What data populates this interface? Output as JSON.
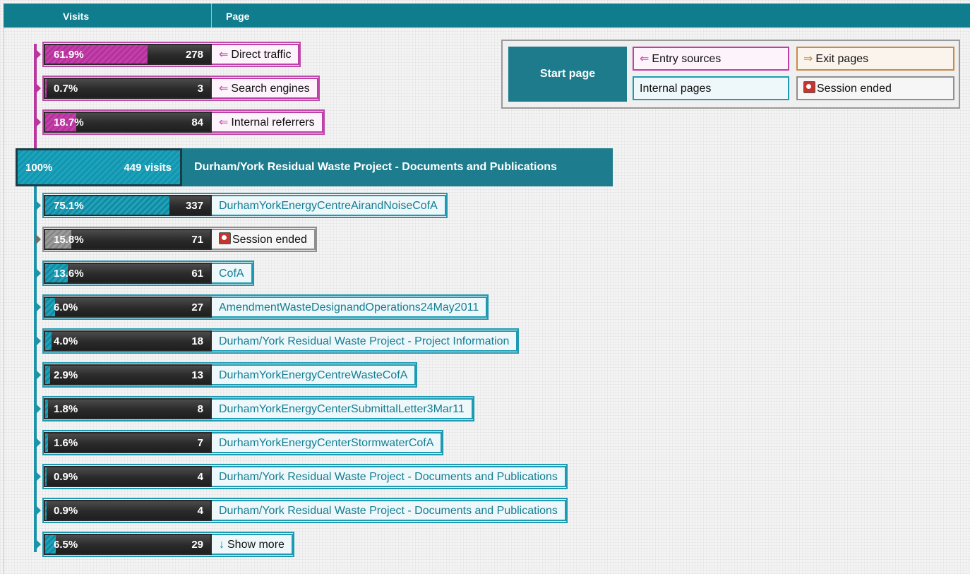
{
  "header": {
    "visits_label": "Visits",
    "page_label": "Page"
  },
  "legend": {
    "start_page": "Start page",
    "entry_sources": "Entry sources",
    "exit_pages": "Exit pages",
    "internal_pages": "Internal pages",
    "session_ended": "Session ended"
  },
  "entry_sources": [
    {
      "percent": "61.9%",
      "fraction": 0.619,
      "count": "278",
      "label": "Direct traffic"
    },
    {
      "percent": "0.7%",
      "fraction": 0.007,
      "count": "3",
      "label": "Search engines"
    },
    {
      "percent": "18.7%",
      "fraction": 0.187,
      "count": "84",
      "label": "Internal referrers"
    }
  ],
  "start_page": {
    "percent": "100%",
    "fraction": 1.0,
    "visits": "449 visits",
    "title": "Durham/York Residual Waste Project - Documents and Publications"
  },
  "next_pages": [
    {
      "type": "internal",
      "percent": "75.1%",
      "fraction": 0.751,
      "count": "337",
      "label": "DurhamYorkEnergyCentreAirandNoiseCofA"
    },
    {
      "type": "ended",
      "percent": "15.8%",
      "fraction": 0.158,
      "count": "71",
      "label": "Session ended"
    },
    {
      "type": "internal",
      "percent": "13.6%",
      "fraction": 0.136,
      "count": "61",
      "label": "CofA"
    },
    {
      "type": "internal",
      "percent": "6.0%",
      "fraction": 0.06,
      "count": "27",
      "label": "AmendmentWasteDesignandOperations24May2011"
    },
    {
      "type": "internal",
      "percent": "4.0%",
      "fraction": 0.04,
      "count": "18",
      "label": "Durham/York Residual Waste Project - Project Information"
    },
    {
      "type": "internal",
      "percent": "2.9%",
      "fraction": 0.029,
      "count": "13",
      "label": "DurhamYorkEnergyCentreWasteCofA"
    },
    {
      "type": "internal",
      "percent": "1.8%",
      "fraction": 0.018,
      "count": "8",
      "label": "DurhamYorkEnergyCenterSubmittalLetter3Mar11"
    },
    {
      "type": "internal",
      "percent": "1.6%",
      "fraction": 0.016,
      "count": "7",
      "label": "DurhamYorkEnergyCenterStormwaterCofA"
    },
    {
      "type": "internal",
      "percent": "0.9%",
      "fraction": 0.009,
      "count": "4",
      "label": "Durham/York Residual Waste Project - Documents and Publications"
    },
    {
      "type": "internal",
      "percent": "0.9%",
      "fraction": 0.009,
      "count": "4",
      "label": "Durham/York Residual Waste Project - Documents and Publications"
    },
    {
      "type": "more",
      "percent": "6.5%",
      "fraction": 0.065,
      "count": "29",
      "label": "Show more"
    }
  ],
  "colors": {
    "header": "#0f7d8e",
    "entry": "#be3fa6",
    "internal": "#1e9bb3",
    "exit": "#c78a4a",
    "ended": "#8f8f8f",
    "start_label": "#1d7c8d"
  },
  "icons": {
    "entry": "arrow-left-icon",
    "exit": "arrow-right-icon",
    "ended": "session-ended-icon",
    "more": "arrow-down-icon"
  }
}
